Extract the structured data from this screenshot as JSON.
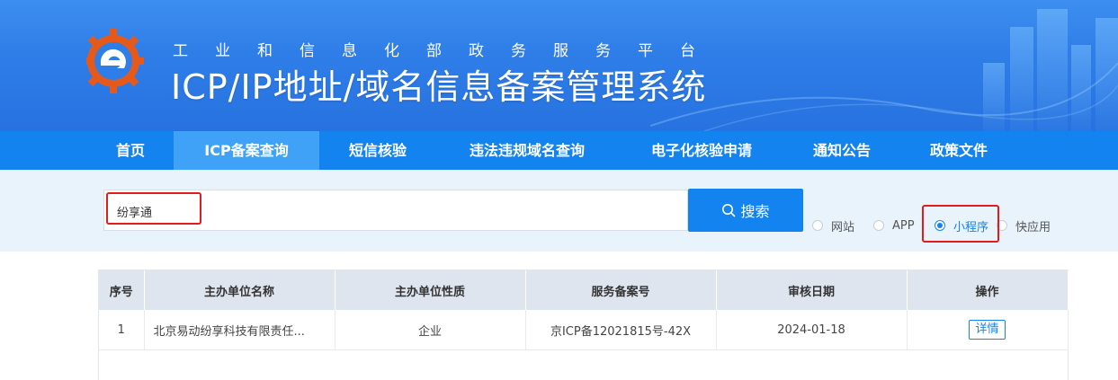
{
  "header": {
    "subtitle": "工业和信息化部政务服务平台",
    "title": "ICP/IP地址/域名信息备案管理系统"
  },
  "nav": {
    "items": [
      {
        "label": "首页"
      },
      {
        "label": "ICP备案查询"
      },
      {
        "label": "短信核验"
      },
      {
        "label": "违法违规域名查询"
      },
      {
        "label": "电子化核验申请"
      },
      {
        "label": "通知公告"
      },
      {
        "label": "政策文件"
      }
    ],
    "active_index": 1
  },
  "search": {
    "value": "纷享通",
    "button_label": "搜索",
    "options": [
      "网站",
      "APP",
      "小程序",
      "快应用"
    ],
    "selected": "小程序"
  },
  "table": {
    "headers": [
      "序号",
      "主办单位名称",
      "主办单位性质",
      "服务备案号",
      "审核日期",
      "操作"
    ],
    "rows": [
      {
        "index": "1",
        "org_name": "北京易动纷享科技有限责任...",
        "org_type": "企业",
        "record_no": "京ICP备12021815号-42X",
        "date": "2024-01-18",
        "action": "详情"
      }
    ]
  },
  "colors": {
    "nav_bg": "#1384ef",
    "nav_active": "#3fa2f7",
    "highlight_box": "#e21b1b"
  }
}
